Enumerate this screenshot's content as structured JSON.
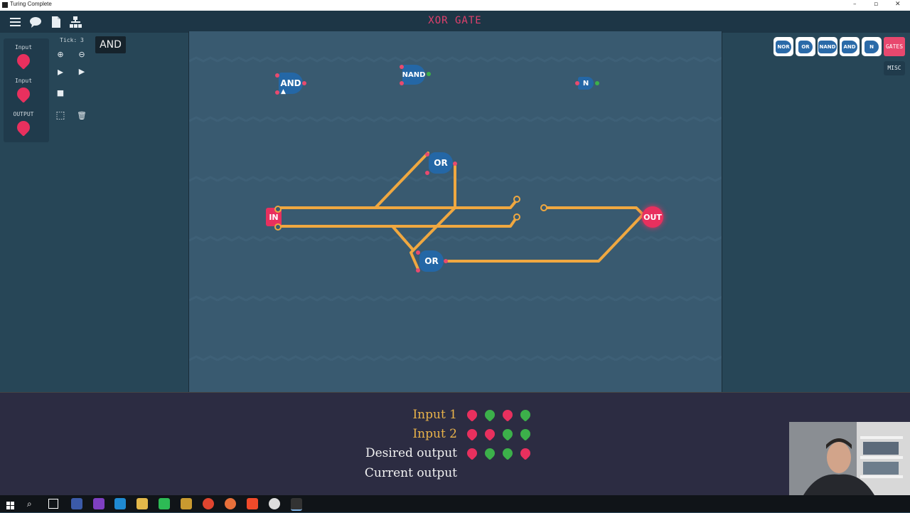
{
  "window": {
    "title": "Turing Complete",
    "controls": [
      "–",
      "▫",
      "✕"
    ]
  },
  "header": {
    "level_title": "XOR GATE",
    "icons": [
      "menu-icon",
      "chat-icon",
      "document-icon",
      "hierarchy-icon"
    ]
  },
  "palette": {
    "items": [
      {
        "label": "Input"
      },
      {
        "label": "Input"
      },
      {
        "label": "OUTPUT"
      }
    ]
  },
  "controls": {
    "tick_label": "Tick: 3",
    "tooltip": "AND",
    "zoom_in": "⊕",
    "zoom_out": "⊖",
    "step": "▸",
    "play": "▶",
    "stop": "■",
    "select": "⬚",
    "delete": "🗑"
  },
  "gates_toolbar": {
    "chips": [
      "NOR",
      "OR",
      "NAND",
      "AND",
      "N"
    ],
    "gates_label": "GATES",
    "misc_label": "MISC"
  },
  "canvas": {
    "gates": [
      {
        "label": "AND"
      },
      {
        "label": "NAND"
      },
      {
        "label": "N"
      },
      {
        "label": "OR"
      },
      {
        "label": "OR"
      },
      {
        "label": "IN"
      },
      {
        "label": "OUT"
      }
    ]
  },
  "truth_table": {
    "rows": [
      {
        "label": "Input 1",
        "color": "#e8b24a",
        "values": [
          0,
          1,
          0,
          1
        ]
      },
      {
        "label": "Input 2",
        "color": "#e8b24a",
        "values": [
          0,
          0,
          1,
          1
        ]
      },
      {
        "label": "Desired output",
        "color": "#f2f2f2",
        "values": [
          0,
          1,
          1,
          0
        ]
      },
      {
        "label": "Current output",
        "color": "#f2f2f2",
        "values": []
      }
    ],
    "on_color": "#3cb04a",
    "off_color": "#e8305e"
  },
  "colors": {
    "wire": "#f0a840",
    "gate_blue": "#2467a6",
    "accent_red": "#e8305e"
  }
}
